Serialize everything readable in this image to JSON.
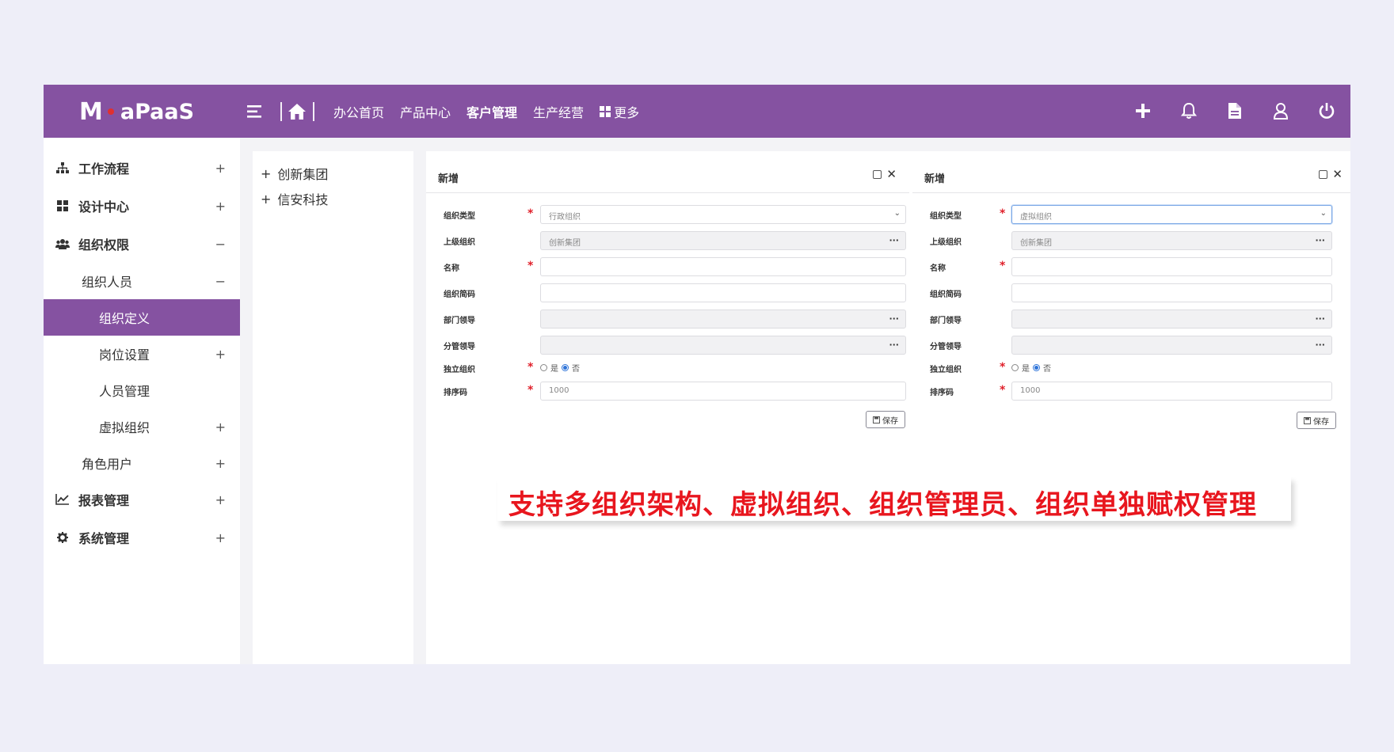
{
  "app": {
    "logo_text": "aPaaS",
    "logo_mark": "M"
  },
  "nav": {
    "items": [
      "办公首页",
      "产品中心",
      "客户管理",
      "生产经营"
    ],
    "active": "客户管理",
    "more": "更多"
  },
  "header_icons": [
    "menu-icon",
    "home-icon",
    "plus-icon",
    "bell-icon",
    "document-icon",
    "user-icon",
    "power-icon"
  ],
  "sidebar": {
    "items": [
      {
        "label": "工作流程",
        "toggle": "+"
      },
      {
        "label": "设计中心",
        "toggle": "+"
      },
      {
        "label": "组织权限",
        "toggle": "−"
      },
      {
        "label": "组织人员",
        "toggle": "−"
      },
      {
        "label": "组织定义",
        "toggle": ""
      },
      {
        "label": "岗位设置",
        "toggle": "+"
      },
      {
        "label": "人员管理",
        "toggle": ""
      },
      {
        "label": "虚拟组织",
        "toggle": "+"
      },
      {
        "label": "角色用户",
        "toggle": "+"
      },
      {
        "label": "报表管理",
        "toggle": "+"
      },
      {
        "label": "系统管理",
        "toggle": "+"
      }
    ]
  },
  "tree": {
    "items": [
      {
        "label": "创新集团",
        "toggle": "+"
      },
      {
        "label": "信安科技",
        "toggle": "+"
      }
    ]
  },
  "form_left": {
    "title": "新增",
    "labels": {
      "type": "组织类型",
      "parent": "上级组织",
      "name": "名称",
      "short": "组织简码",
      "dept_lead": "部门领导",
      "branch_lead": "分管领导",
      "independent": "独立组织",
      "sort": "排序码"
    },
    "values": {
      "type": "行政组织",
      "parent": "创新集团",
      "name": "",
      "short": "",
      "dept_lead": "",
      "branch_lead": "",
      "sort": "1000"
    },
    "radio": {
      "yes": "是",
      "no": "否",
      "selected": "no"
    },
    "save": "保存",
    "ellipsis": "···"
  },
  "form_right": {
    "title": "新增",
    "labels": {
      "type": "组织类型",
      "parent": "上级组织",
      "name": "名称",
      "short": "组织简码",
      "dept_lead": "部门领导",
      "branch_lead": "分管领导",
      "independent": "独立组织",
      "sort": "排序码"
    },
    "values": {
      "type": "虚拟组织",
      "parent": "创新集团",
      "name": "",
      "short": "",
      "dept_lead": "",
      "branch_lead": "",
      "sort": "1000"
    },
    "radio": {
      "yes": "是",
      "no": "否",
      "selected": "no"
    },
    "save": "保存",
    "ellipsis": "···"
  },
  "slogan": "支持多组织架构、虚拟组织、组织管理员、组织单独赋权管理",
  "colors": {
    "header": "#8552a1",
    "accent": "#8552a1",
    "required": "#e0202a",
    "slogan": "#e8161e"
  }
}
